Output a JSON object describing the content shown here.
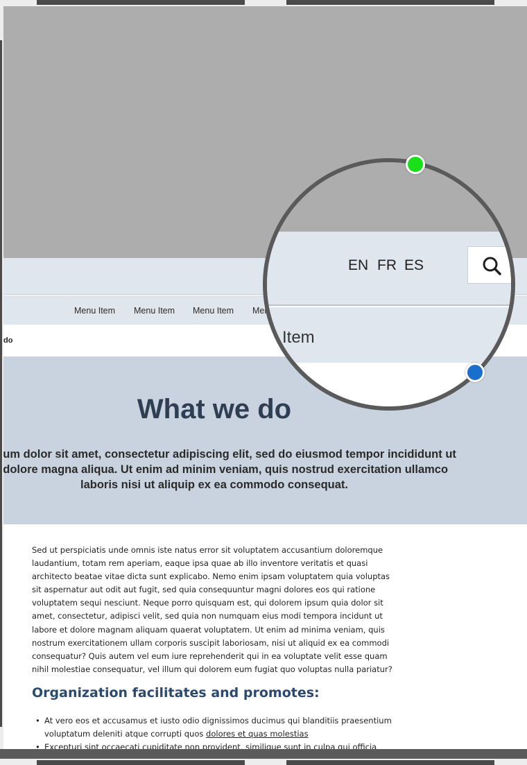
{
  "nav": {
    "items": [
      "Menu Item",
      "Menu Item",
      "Menu Item",
      "Men"
    ]
  },
  "breadcrumb": {
    "current": "do"
  },
  "banner": {
    "title": "What we do",
    "lines": [
      "psum dolor sit amet, consectetur adipiscing elit, sed do eiusmod tempor incididunt ut",
      "et dolore magna aliqua. Ut enim ad minim veniam, quis nostrud exercitation ullamco",
      "laboris nisi ut aliquip ex ea commodo consequat."
    ]
  },
  "content": {
    "paragraph": "Sed ut perspiciatis unde omnis iste natus error sit voluptatem accusantium doloremque laudantium, totam rem aperiam, eaque ipsa quae ab illo inventore veritatis et quasi architecto beatae vitae dicta sunt explicabo. Nemo enim ipsam voluptatem quia voluptas sit aspernatur aut odit aut fugit, sed quia consequuntur magni dolores eos qui ratione voluptatem sequi nesciunt. Neque porro quisquam est, qui dolorem ipsum quia dolor sit amet, consectetur, adipisci velit, sed quia non numquam eius modi tempora incidunt ut labore et dolore magnam aliquam quaerat voluptatem. Ut enim ad minima veniam, quis nostrum exercitationem ullam corporis suscipit laboriosam, nisi ut aliquid ex ea commodi consequatur? Quis autem vel eum iure reprehenderit qui in ea voluptate velit esse quam nihil molestiae consequatur, vel illum qui dolorem eum fugiat quo voluptas nulla pariatur?",
    "section_title": "Organization facilitates and promotes:",
    "bullet1_text": "At vero eos et accusamus et iusto odio dignissimos ducimus qui blanditiis praesentium voluptatum deleniti atque corrupti quos ",
    "bullet1_link": "dolores et quas molestias",
    "bullet2_text": "Excepturi sint occaecati cupiditate non provident, similique sunt in culpa qui officia"
  },
  "magnifier": {
    "languages": [
      "EN",
      "FR",
      "ES"
    ],
    "search_icon": "search-icon",
    "nav_label": "Item",
    "handle_colors": {
      "top": "#19e019",
      "bottom": "#1a6fcc"
    }
  }
}
